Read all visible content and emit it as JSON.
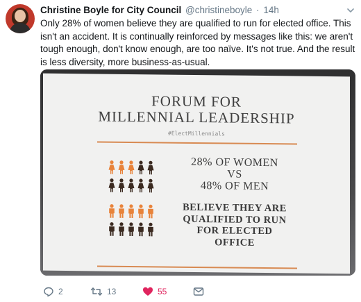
{
  "tweet": {
    "author_name": "Christine Boyle for City Council",
    "handle": "@christineboyle",
    "separator": "·",
    "time": "14h",
    "text": "Only 28% of women believe they are qualified to run for elected office. This isn't an accident. It is continually reinforced by messages like this: we aren't tough enough, don't know enough, are too naïve. It's not true. And the result is less diversity, more business-as-usual."
  },
  "slide": {
    "title_line1": "FORUM FOR",
    "title_line2": "MILLENNIAL LEADERSHIP",
    "hashtag": "#ElectMillennials",
    "stat_line1": "28% OF WOMEN",
    "stat_line2": "VS",
    "stat_line3": "48% OF MEN",
    "caption_line1": "BELIEVE THEY ARE",
    "caption_line2": "QUALIFIED TO RUN",
    "caption_line3": "FOR ELECTED",
    "caption_line4": "OFFICE",
    "women_qualified_fraction": 0.28,
    "men_qualified_fraction": 0.48
  },
  "actions": {
    "reply_count": "2",
    "retweet_count": "13",
    "like_count": "55"
  },
  "colors": {
    "accent_orange": "#e8833a",
    "dark_figure": "#3b2a20",
    "like_pink": "#e0245e",
    "muted_text": "#657786"
  },
  "icons": [
    "avatar",
    "chevron-down-icon",
    "reply-icon",
    "retweet-icon",
    "heart-icon",
    "message-icon",
    "woman-icon",
    "man-icon"
  ]
}
